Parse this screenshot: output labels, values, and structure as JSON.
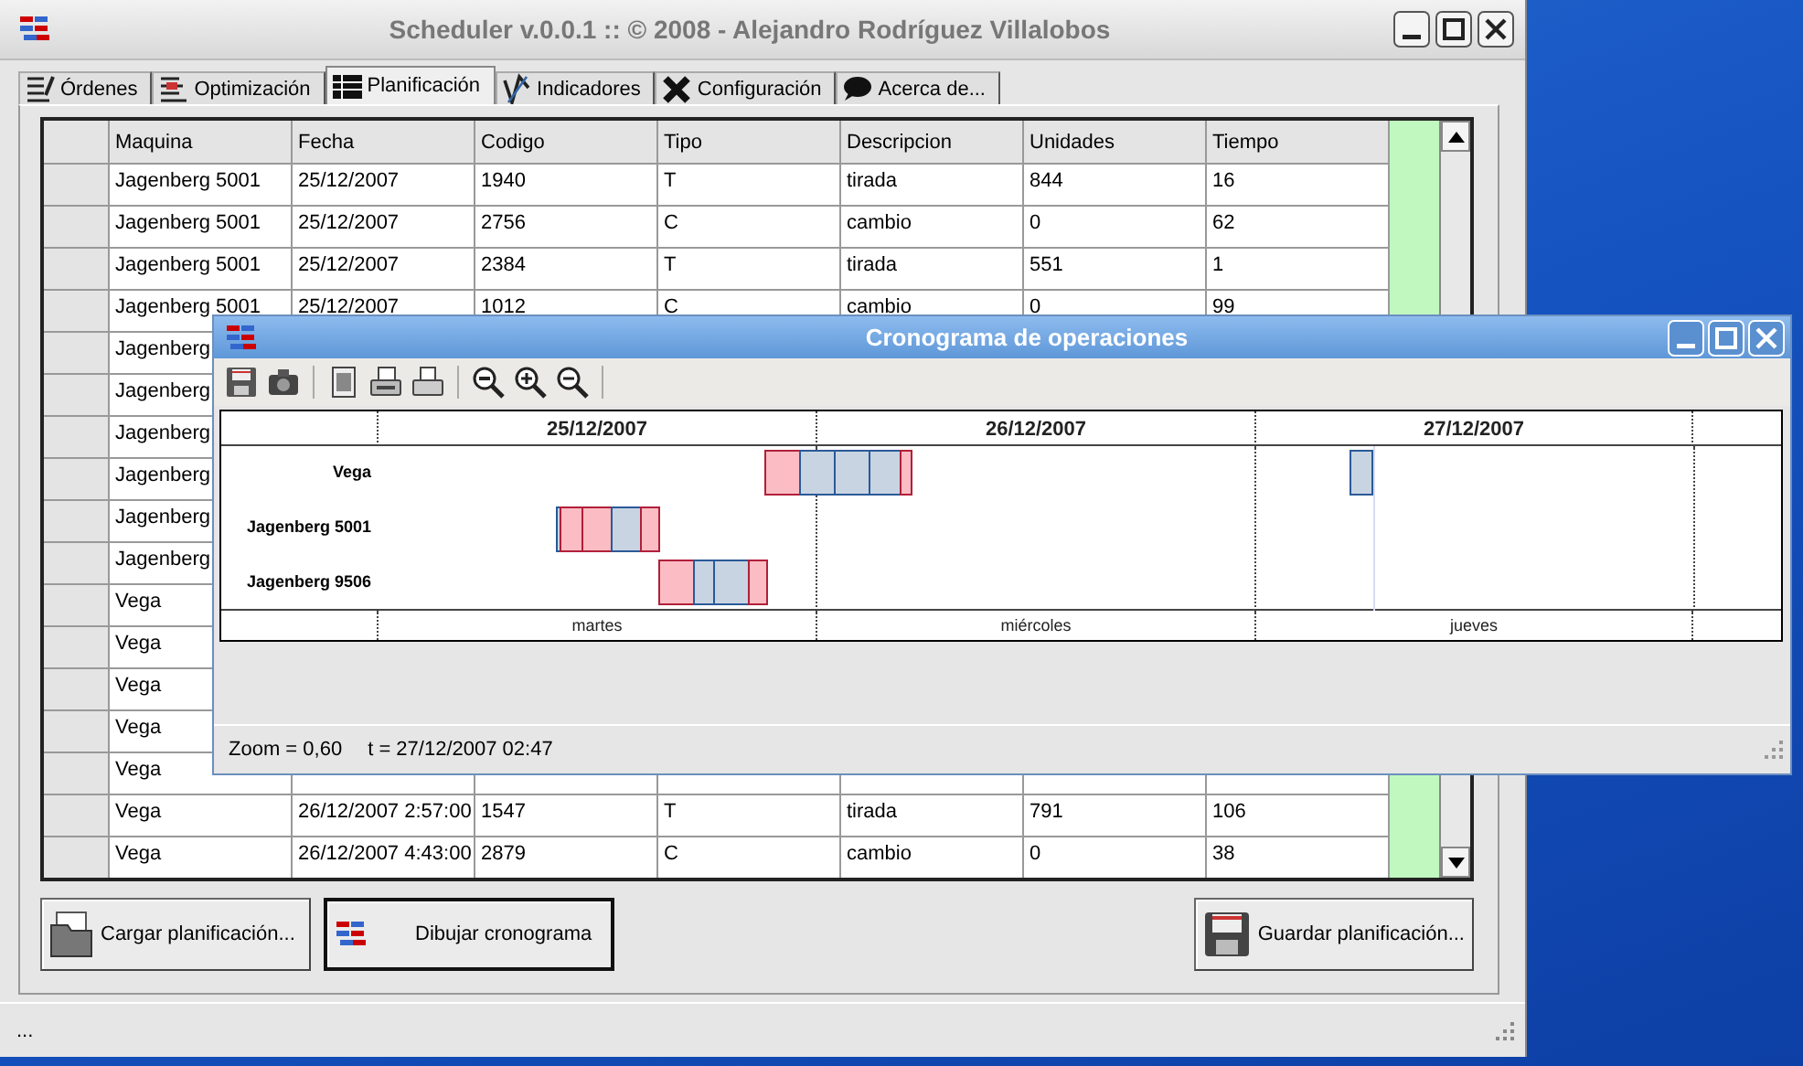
{
  "window": {
    "title": "Scheduler v.0.0.1 :: © 2008 - Alejandro Rodríguez Villalobos"
  },
  "tabs": [
    {
      "label": "Órdenes",
      "selected": false
    },
    {
      "label": "Optimización",
      "selected": false
    },
    {
      "label": "Planificación",
      "selected": true
    },
    {
      "label": "Indicadores",
      "selected": false
    },
    {
      "label": "Configuración",
      "selected": false
    },
    {
      "label": "Acerca de...",
      "selected": false
    }
  ],
  "table": {
    "columns": [
      "Maquina",
      "Fecha",
      "Codigo",
      "Tipo",
      "Descripcion",
      "Unidades",
      "Tiempo"
    ],
    "rows": [
      [
        "Jagenberg 5001",
        "25/12/2007",
        "1940",
        "T",
        "tirada",
        "844",
        "16"
      ],
      [
        "Jagenberg 5001",
        "25/12/2007",
        "2756",
        "C",
        "cambio",
        "0",
        "62"
      ],
      [
        "Jagenberg 5001",
        "25/12/2007",
        "2384",
        "T",
        "tirada",
        "551",
        "1"
      ],
      [
        "Jagenberg 5001",
        "25/12/2007",
        "1012",
        "C",
        "cambio",
        "0",
        "99"
      ],
      [
        "Jagenberg"
      ],
      [
        "Jagenberg"
      ],
      [
        "Jagenberg"
      ],
      [
        "Jagenberg"
      ],
      [
        "Jagenberg"
      ],
      [
        "Jagenberg"
      ],
      [
        "Vega"
      ],
      [
        "Vega"
      ],
      [
        "Vega"
      ],
      [
        "Vega"
      ],
      [
        "Vega"
      ],
      [
        "Vega",
        "26/12/2007 2:57:00",
        "1547",
        "T",
        "tirada",
        "791",
        "106"
      ],
      [
        "Vega",
        "26/12/2007 4:43:00",
        "2879",
        "C",
        "cambio",
        "0",
        "38"
      ]
    ]
  },
  "buttons": [
    {
      "kind": "load",
      "label": "Cargar planificación...",
      "default": false
    },
    {
      "kind": "draw",
      "label": "Dibujar cronograma",
      "default": true
    },
    {
      "kind": "save",
      "label": "Guardar planificación...",
      "default": false
    }
  ],
  "status_bar": "...",
  "chart_window": {
    "title": "Cronograma de operaciones",
    "dates": [
      "25/12/2007",
      "26/12/2007",
      "27/12/2007"
    ],
    "machines": [
      "Vega",
      "Jagenberg 5001",
      "Jagenberg 9506"
    ],
    "days": [
      "martes",
      "miércoles",
      "jueves"
    ],
    "zoom": "Zoom = 0,60",
    "time": "t = 27/12/2007 02:47"
  }
}
